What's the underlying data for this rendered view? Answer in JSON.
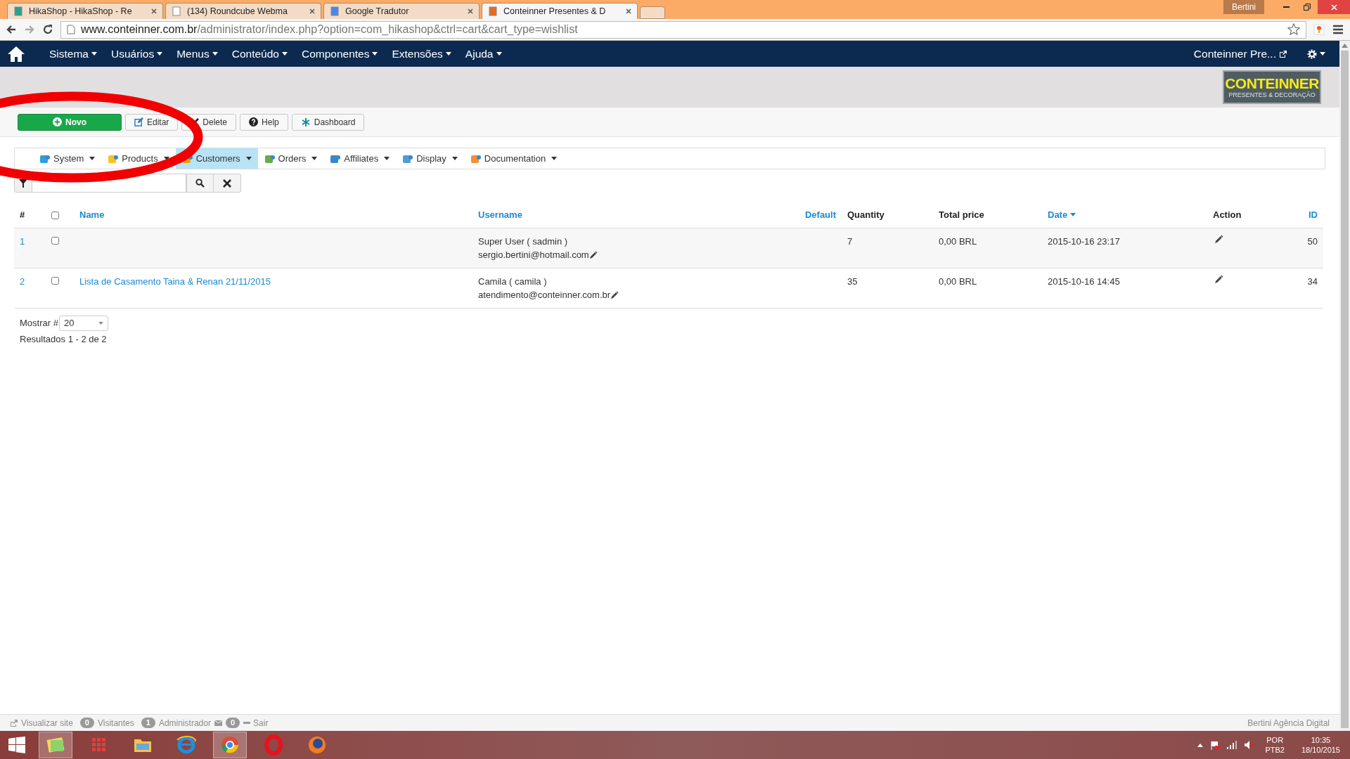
{
  "browser": {
    "tabs": [
      {
        "title": "HikaShop - HikaShop - Re",
        "selected": false
      },
      {
        "title": "(134) Roundcube Webma",
        "selected": false
      },
      {
        "title": "Google Tradutor",
        "selected": false
      },
      {
        "title": "Conteinner Presentes & D",
        "selected": true
      }
    ],
    "user": "Bertini",
    "url_host": "www.conteinner.com.br",
    "url_path": "/administrator/index.php?option=com_hikashop&ctrl=cart&cart_type=wishlist"
  },
  "admin_menu": {
    "items": [
      "Sistema",
      "Usuários",
      "Menus",
      "Conteúdo",
      "Componentes",
      "Extensões",
      "Ajuda"
    ],
    "site_link": "Conteinner Pre..."
  },
  "logo": {
    "title": "CONTEINNER",
    "subtitle": "PRESENTES & DECORAÇÃO"
  },
  "toolbar": [
    {
      "label": "Novo",
      "kind": "primary"
    },
    {
      "label": "Editar",
      "kind": "edit"
    },
    {
      "label": "Delete",
      "kind": "delete"
    },
    {
      "label": "Help",
      "kind": "help"
    },
    {
      "label": "Dashboard",
      "kind": "dashboard"
    }
  ],
  "submenu": [
    {
      "label": "System",
      "selected": false
    },
    {
      "label": "Products",
      "selected": false
    },
    {
      "label": "Customers",
      "selected": true
    },
    {
      "label": "Orders",
      "selected": false
    },
    {
      "label": "Affiliates",
      "selected": false
    },
    {
      "label": "Display",
      "selected": false
    },
    {
      "label": "Documentation",
      "selected": false
    }
  ],
  "table": {
    "select_all_checked": false,
    "columns": [
      {
        "label": "#",
        "sortable": false
      },
      {
        "label": "Name",
        "sortable": true
      },
      {
        "label": "Username",
        "sortable": true
      },
      {
        "label": "Default",
        "sortable": true
      },
      {
        "label": "Quantity",
        "sortable": false
      },
      {
        "label": "Total price",
        "sortable": false
      },
      {
        "label": "Date",
        "sortable": true
      },
      {
        "label": "Action",
        "sortable": false
      },
      {
        "label": "ID",
        "sortable": true
      }
    ],
    "rows": [
      {
        "num": "1",
        "checked": false,
        "name": "",
        "user": "Super User ( sadmin )",
        "email": "sergio.bertini@hotmail.com",
        "quantity": "7",
        "total": "0,00 BRL",
        "date": "2015-10-16 23:17",
        "id": "50"
      },
      {
        "num": "2",
        "checked": false,
        "name": "Lista de Casamento Taina & Renan 21/11/2015",
        "user": "Camila ( camila )",
        "email": "atendimento@conteinner.com.br",
        "quantity": "35",
        "total": "0,00 BRL",
        "date": "2015-10-16 14:45",
        "id": "34"
      }
    ]
  },
  "pagination": {
    "label": "Mostrar #",
    "value": "20",
    "results": "Resultados 1 - 2 de 2"
  },
  "status_bar": {
    "view_site": "Visualizar site",
    "visitors_count": "0",
    "visitors": "Visitantes",
    "admins_count": "1",
    "admins": "Administrador",
    "messages_count": "0",
    "logout": "Sair",
    "credit": "Bertini Agência Digital"
  },
  "taskbar": {
    "lang": "POR",
    "layout": "PTB2",
    "time": "10:35",
    "date": "18/10/2015"
  }
}
